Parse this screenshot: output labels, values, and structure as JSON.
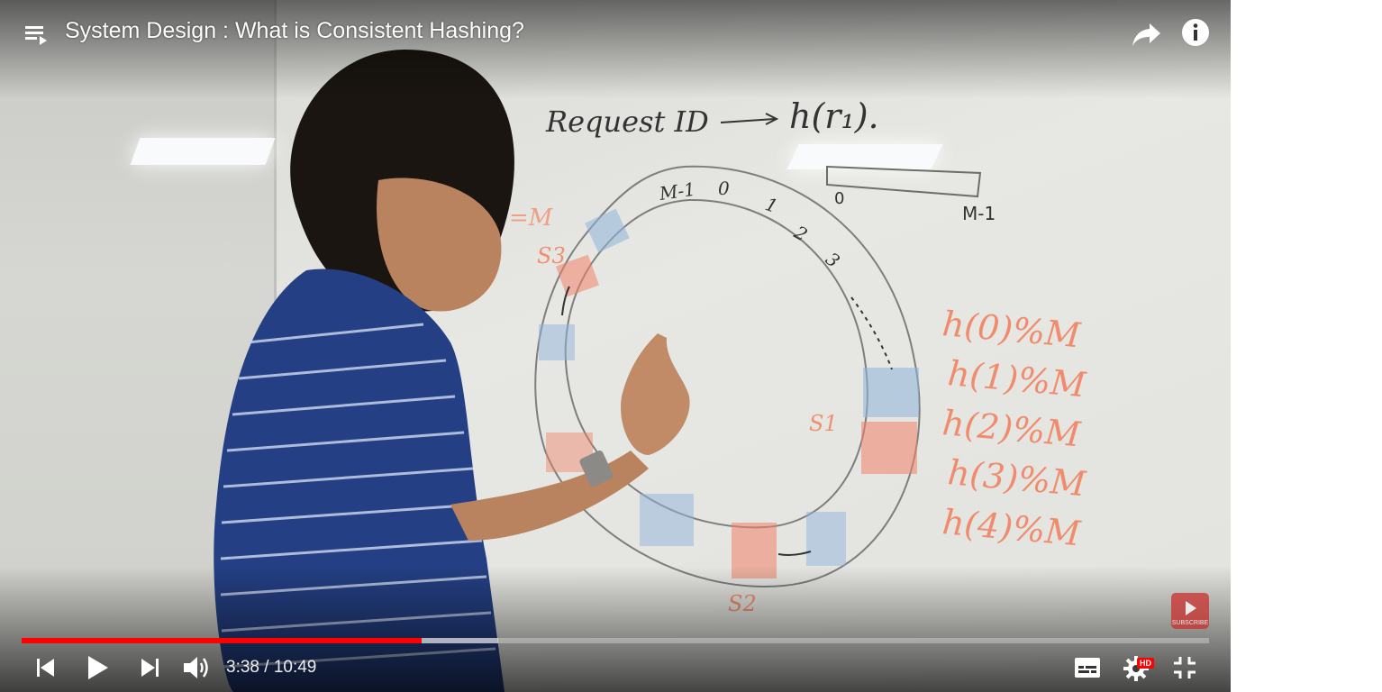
{
  "player": {
    "title": "System Design : What is Consistent Hashing?",
    "current_time": "3:38",
    "duration": "10:49",
    "progress_fraction": 0.337,
    "buffered_fraction": 0.401,
    "hd_label": "HD",
    "subscribe_label": "SUBSCRIBE",
    "accent_color": "#ff0000"
  },
  "icons": {
    "playlist": "playlist-icon",
    "share": "share-icon",
    "info": "info-icon",
    "previous": "previous-icon",
    "play": "play-icon",
    "next": "next-icon",
    "volume": "volume-icon",
    "captions": "captions-icon",
    "settings": "gear-icon",
    "fullscreen_exit": "exit-fullscreen-icon"
  },
  "whiteboard": {
    "request_text": "Request ID",
    "hash_text": "h(r₁).",
    "array_start": "0",
    "array_end": "M-1",
    "ring_slots": [
      "M-1",
      "0",
      "1",
      "2",
      "3"
    ],
    "server_labels": [
      "S1",
      "S2",
      "S3"
    ],
    "hash_list": [
      "h(0)%M",
      "h(1)%M",
      "h(2)%M",
      "h(3)%M",
      "h(4)%M"
    ],
    "partial_left": "=M"
  }
}
